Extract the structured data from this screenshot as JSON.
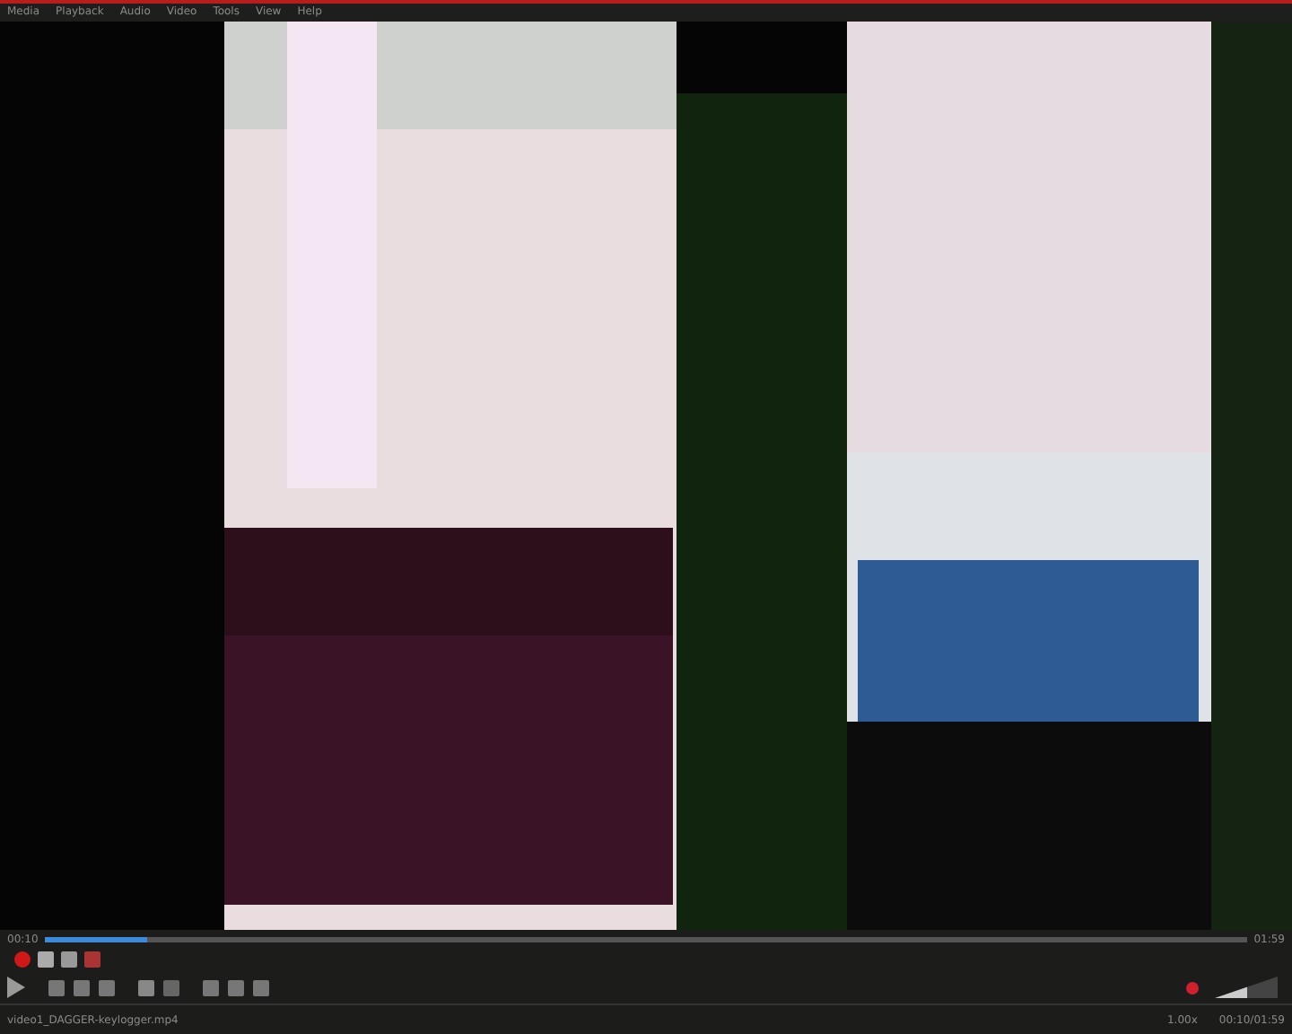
{
  "menu": [
    "Media",
    "Playback",
    "Audio",
    "Video",
    "Tools",
    "View",
    "Help"
  ],
  "seek": {
    "elapsed": "00:10",
    "total": "01:59",
    "level": 0.085
  },
  "volume": {
    "level": 0.5
  },
  "status_bar": {
    "file": "video1_DAGGER-keylogger.mp4",
    "speed": "1.00x",
    "time": "00:10/01:59"
  }
}
